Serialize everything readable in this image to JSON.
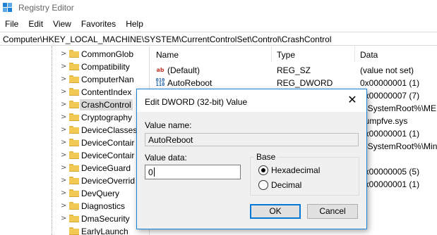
{
  "window": {
    "title": "Registry Editor",
    "accent": "#1883d7"
  },
  "menu": [
    "File",
    "Edit",
    "View",
    "Favorites",
    "Help"
  ],
  "address": "Computer\\HKEY_LOCAL_MACHINE\\SYSTEM\\CurrentControlSet\\Control\\CrashControl",
  "tree": {
    "items": [
      {
        "label": "CommonGlob",
        "selected": false
      },
      {
        "label": "Compatibility",
        "selected": false
      },
      {
        "label": "ComputerNan",
        "selected": false
      },
      {
        "label": "ContentIndex",
        "selected": false
      },
      {
        "label": "CrashControl",
        "selected": true
      },
      {
        "label": "Cryptography",
        "selected": false
      },
      {
        "label": "DeviceClasses",
        "selected": false
      },
      {
        "label": "DeviceContair",
        "selected": false
      },
      {
        "label": "DeviceContair",
        "selected": false
      },
      {
        "label": "DeviceGuard",
        "selected": false
      },
      {
        "label": "DeviceOverrid",
        "selected": false
      },
      {
        "label": "DevQuery",
        "selected": false
      },
      {
        "label": "Diagnostics",
        "selected": false
      },
      {
        "label": "DmaSecurity",
        "selected": false
      },
      {
        "label": "EarlyLaunch",
        "selected": false
      }
    ]
  },
  "list": {
    "headers": {
      "name": "Name",
      "type": "Type",
      "data": "Data"
    },
    "rows": [
      {
        "icon": "string-value-icon",
        "icon_text": "ab",
        "name": "(Default)",
        "type": "REG_SZ",
        "data": "(value not set)"
      },
      {
        "icon": "dword-value-icon",
        "icon_text": "01",
        "name": "AutoReboot",
        "type": "REG_DWORD",
        "data": "0x00000001 (1)"
      },
      {
        "icon": "",
        "icon_text": "",
        "name": "",
        "type": "",
        "data": "0x00000007 (7)"
      },
      {
        "icon": "",
        "icon_text": "",
        "name": "",
        "type": "",
        "data": "%SystemRoot%\\MEM"
      },
      {
        "icon": "",
        "icon_text": "",
        "name": "",
        "type": "",
        "data": "dumpfve.sys"
      },
      {
        "icon": "",
        "icon_text": "",
        "name": "",
        "type": "",
        "data": "0x00000001 (1)"
      },
      {
        "icon": "",
        "icon_text": "",
        "name": "",
        "type": "",
        "data": "%SystemRoot%\\Mini"
      },
      {
        "icon": "",
        "icon_text": "",
        "name": "",
        "type": "",
        "data": "0x00000005 (5)"
      },
      {
        "icon": "",
        "icon_text": "",
        "name": "",
        "type": "",
        "data": "0x00000001 (1)"
      }
    ]
  },
  "dialog": {
    "title": "Edit DWORD (32-bit) Value",
    "close_glyph": "✕",
    "value_name_label": "Value name:",
    "value_name": "AutoReboot",
    "value_data_label": "Value data:",
    "value_data": "0",
    "base_label": "Base",
    "base_options": [
      "Hexadecimal",
      "Decimal"
    ],
    "base_selected": "Hexadecimal",
    "ok_label": "OK",
    "cancel_label": "Cancel"
  }
}
